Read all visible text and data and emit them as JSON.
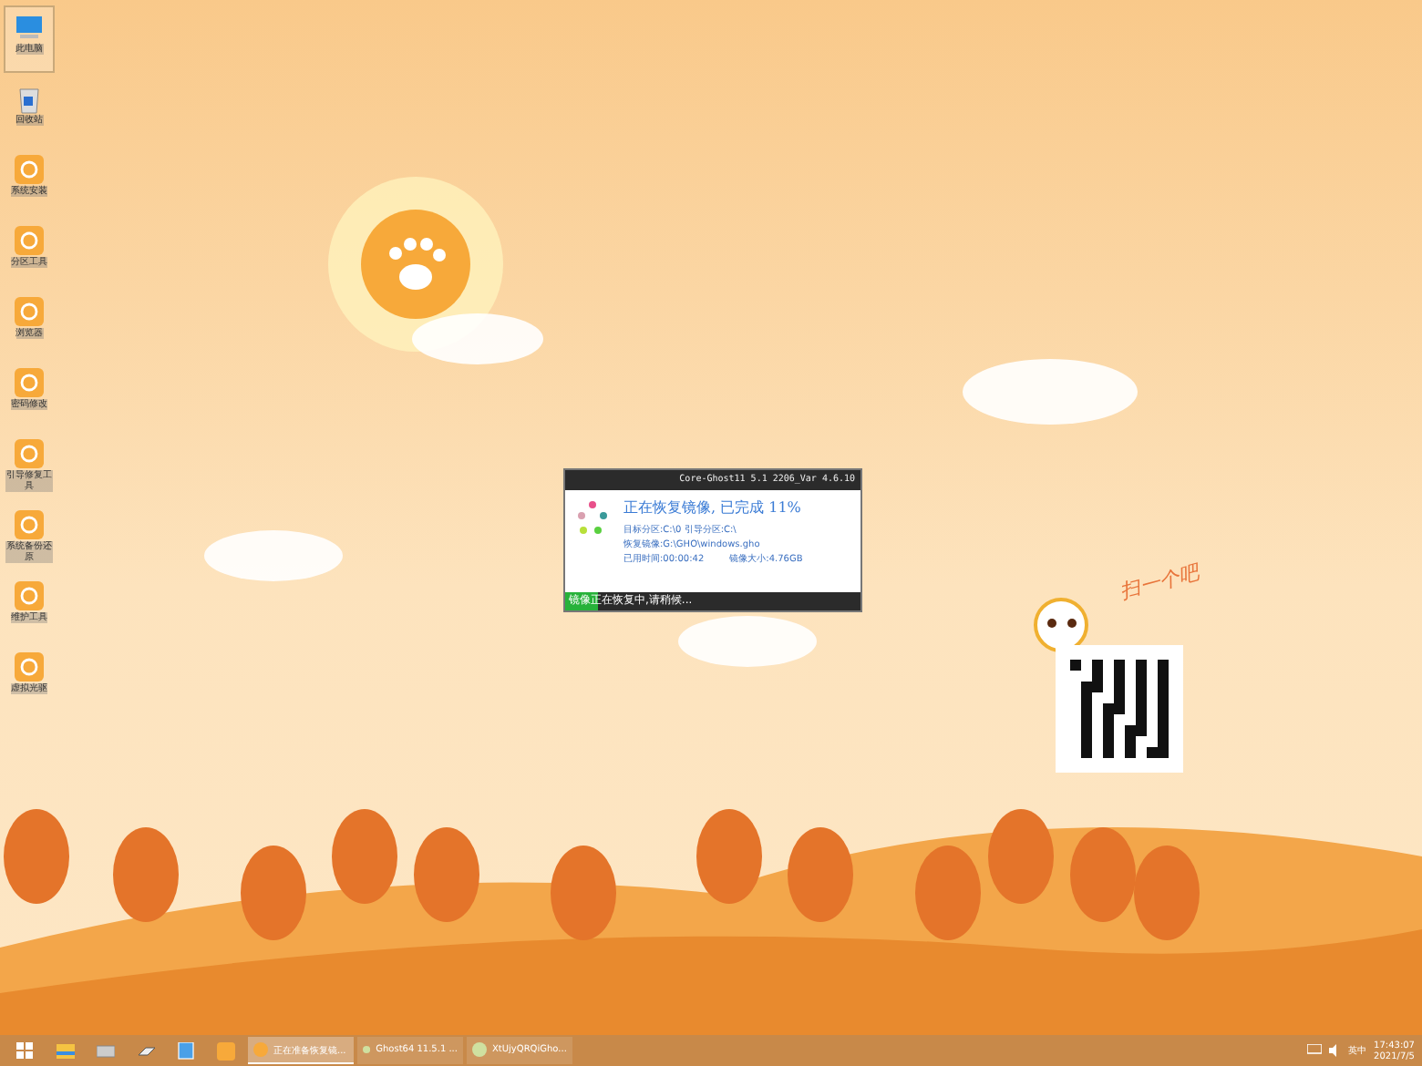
{
  "desktop_icons": [
    {
      "label": "此电脑",
      "selected": true
    },
    {
      "label": "回收站",
      "selected": false
    },
    {
      "label": "系统安装",
      "selected": false
    },
    {
      "label": "分区工具",
      "selected": false
    },
    {
      "label": "浏览器",
      "selected": false
    },
    {
      "label": "密码修改",
      "selected": false
    },
    {
      "label": "引导修复工具",
      "selected": false
    },
    {
      "label": "系统备份还原",
      "selected": false
    },
    {
      "label": "维护工具",
      "selected": false
    },
    {
      "label": "虚拟光驱",
      "selected": false
    }
  ],
  "dialog": {
    "title": "Core-Ghost11 5.1 2206_Var 4.6.10",
    "heading": "正在恢复镜像, 已完成 11%",
    "lines": [
      [
        "目标分区:C:\\0 引导分区:C:\\"
      ],
      [
        "恢复镜像:G:\\GHO\\windows.gho"
      ],
      [
        "已用时间:00:00:42",
        "镜像大小:4.76GB"
      ]
    ],
    "status": "镜像正在恢复中,请稍候...",
    "level": 0.11
  },
  "qr": {
    "caption": "扫一个吧"
  },
  "taskbar": {
    "tasks": [
      {
        "label": "正在准备恢复镜...",
        "selected": true
      },
      {
        "label": "Ghost64 11.5.1 ...",
        "selected": false
      },
      {
        "label": "XtUjyQRQiGho...",
        "selected": false
      }
    ],
    "ime": "英中",
    "time": "17:43:07",
    "date": "2021/7/5"
  }
}
